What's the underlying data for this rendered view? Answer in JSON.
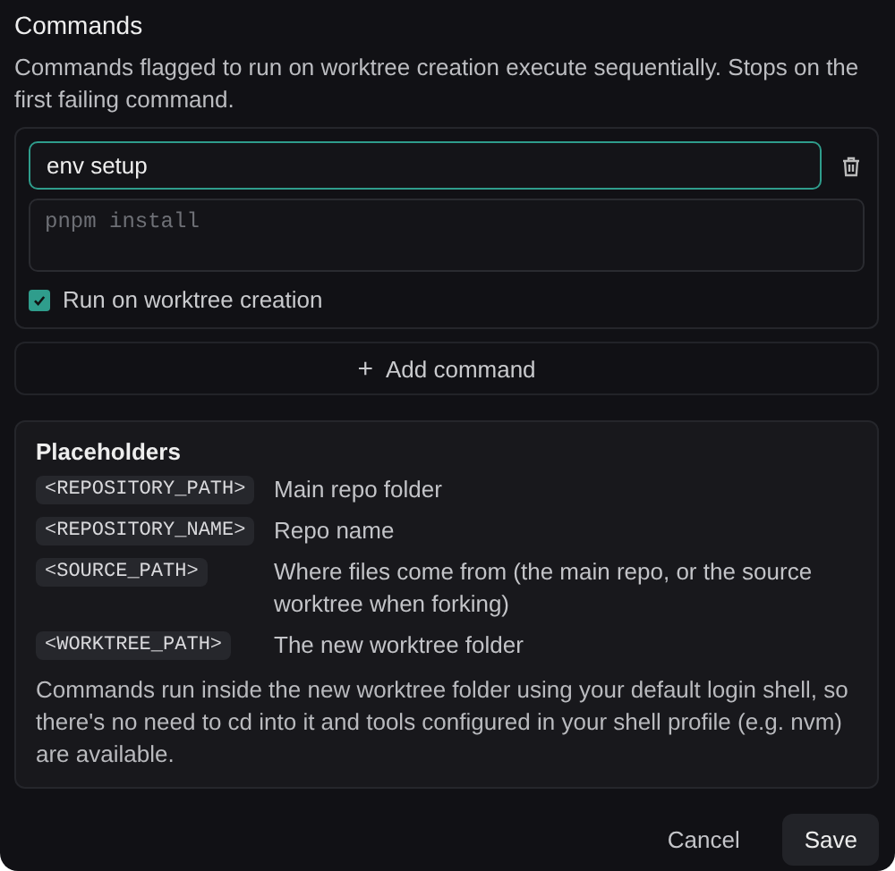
{
  "section_title": "Commands",
  "description": "Commands flagged to run on worktree creation execute sequentially. Stops on the first failing command.",
  "commands": [
    {
      "name": "env setup",
      "command_placeholder": "pnpm install",
      "run_on_creation": true,
      "label": "Run on worktree creation",
      "focused": true
    }
  ],
  "add_button": {
    "icon": "+",
    "label": "Add command"
  },
  "placeholders": {
    "title": "Placeholders",
    "items": [
      {
        "token": "<REPOSITORY_PATH>",
        "meaning": "Main repo folder"
      },
      {
        "token": "<REPOSITORY_NAME>",
        "meaning": "Repo name"
      },
      {
        "token": "<SOURCE_PATH>",
        "meaning": "Where files come from (the main repo, or the source worktree when forking)"
      },
      {
        "token": "<WORKTREE_PATH>",
        "meaning": "The new worktree folder"
      }
    ],
    "note": "Commands run inside the new worktree folder using your default login shell, so there's no need to cd into it and tools configured in your shell profile (e.g. nvm) are available."
  },
  "buttons": [
    {
      "kind": "secondary",
      "label": "Cancel"
    },
    {
      "kind": "primary",
      "label": "Save"
    }
  ]
}
